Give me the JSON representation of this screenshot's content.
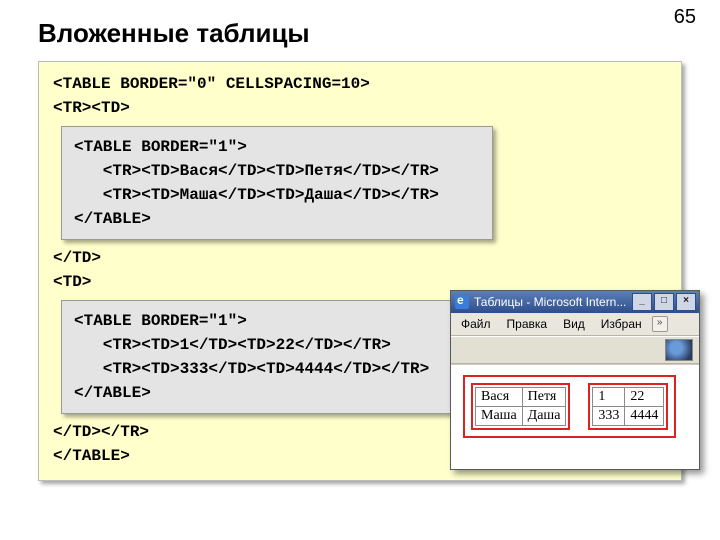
{
  "page_number": "65",
  "title": "Вложенные таблицы",
  "code": {
    "l1": "<TABLE BORDER=\"0\" CELLSPACING=10>",
    "l2": "<TR><TD>",
    "inner1": {
      "a": "<TABLE BORDER=\"1\">",
      "b": "   <TR><TD>Вася</TD><TD>Петя</TD></TR>",
      "c": "   <TR><TD>Маша</TD><TD>Даша</TD></TR>",
      "d": "</TABLE>"
    },
    "l3": "</TD>",
    "l4": "<TD>",
    "inner2": {
      "a": "<TABLE BORDER=\"1\">",
      "b": "   <TR><TD>1</TD><TD>22</TD></TR>",
      "c": "   <TR><TD>333</TD><TD>4444</TD></TR>",
      "d": "</TABLE>"
    },
    "l5": "</TD></TR>",
    "l6": "</TABLE>"
  },
  "browser": {
    "title": "Таблицы - Microsoft Intern...",
    "btn_min": "_",
    "btn_max": "□",
    "btn_close": "×",
    "menu": {
      "file": "Файл",
      "edit": "Правка",
      "view": "Вид",
      "fav": "Избран",
      "chev": "»"
    },
    "table1": {
      "r0c0": "Вася",
      "r0c1": "Петя",
      "r1c0": "Маша",
      "r1c1": "Даша"
    },
    "table2": {
      "r0c0": "1",
      "r0c1": "22",
      "r1c0": "333",
      "r1c1": "4444"
    }
  }
}
